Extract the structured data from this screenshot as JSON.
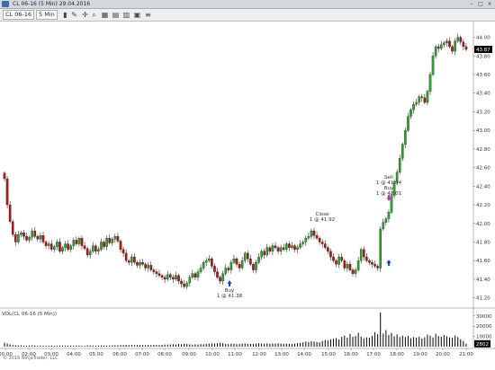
{
  "window": {
    "title": "CL 06-16 (5 Min)  29.04.2016",
    "controls": {
      "minimize": "–",
      "maximize": "□",
      "close": "×"
    }
  },
  "toolbar": {
    "instrument": "CL 06-16",
    "interval": "5 Min",
    "icons": [
      "bar-style-icon",
      "pencil-icon",
      "crosshair-icon",
      "zoom-icon",
      "properties-icon",
      "strategy-icon",
      "chart-trader-icon",
      "data-box-icon",
      "menu-icon"
    ]
  },
  "colors": {
    "up": "#2ea32e",
    "down": "#b01818",
    "wick": "#000000",
    "volume": "#000000",
    "buy_arrow": "#1b3fd6",
    "sell_arrow": "#d21bd6",
    "last_price_bg": "#000000"
  },
  "annotations": {
    "buy1": {
      "label": "Buy",
      "detail": "1 @ 41.38",
      "time": "11:00",
      "price": 41.38
    },
    "close1": {
      "label": "Close",
      "detail": "1 @ 41.92",
      "time": "15:45",
      "price": 41.92
    },
    "sell": {
      "label": "Sell",
      "detail": "1 @ 41.94",
      "time": "17:30",
      "price": 41.94
    },
    "buy2": {
      "label": "Buy",
      "detail": "1 @ 42.01",
      "time": "17:30",
      "price": 42.01
    }
  },
  "volume_panel": {
    "label": "VOL(CL 06-16 (5 Min))",
    "ticks": [
      "30000",
      "20000",
      "10000"
    ],
    "last_value": "2802"
  },
  "copyright": "© 2016 NinjaTrader, LLC",
  "chart_data": [
    {
      "type": "candlestick",
      "title": "CL 06-16 (5 Min)",
      "ylim": [
        41.1,
        44.15
      ],
      "y_ticks": [
        "44.00",
        "43.80",
        "43.60",
        "43.40",
        "43.20",
        "43.00",
        "42.80",
        "42.60",
        "42.40",
        "42.20",
        "42.00",
        "41.80",
        "41.60",
        "41.40",
        "41.20"
      ],
      "x_ticks": [
        "00:00",
        "02:00",
        "03:00",
        "04:00",
        "05:00",
        "06:00",
        "07:00",
        "08:00",
        "09:00",
        "10:00",
        "11:00",
        "12:00",
        "13:00",
        "14:00",
        "15:00",
        "16:00",
        "17:00",
        "18:00",
        "19:00",
        "20:00",
        "21:00"
      ],
      "last_price": "43.87",
      "series": [
        {
          "name": "CL 06-16",
          "values": [
            42.48,
            42.2,
            42.02,
            41.88,
            41.8,
            41.88,
            41.9,
            41.86,
            41.82,
            41.85,
            41.92,
            41.86,
            41.83,
            41.87,
            41.8,
            41.76,
            41.78,
            41.72,
            41.75,
            41.8,
            41.7,
            41.74,
            41.78,
            41.72,
            41.76,
            41.82,
            41.78,
            41.84,
            41.76,
            41.73,
            41.66,
            41.7,
            41.76,
            41.7,
            41.72,
            41.8,
            41.75,
            41.84,
            41.79,
            41.83,
            41.86,
            41.81,
            41.72,
            41.68,
            41.6,
            41.58,
            41.64,
            41.58,
            41.55,
            41.58,
            41.56,
            41.52,
            41.55,
            41.5,
            41.48,
            41.46,
            41.44,
            41.42,
            41.4,
            41.45,
            41.42,
            41.4,
            41.44,
            41.38,
            41.35,
            41.32,
            41.36,
            41.42,
            41.46,
            41.42,
            41.48,
            41.52,
            41.58,
            41.6,
            41.62,
            41.54,
            41.48,
            41.42,
            41.38,
            41.46,
            41.52,
            41.5,
            41.58,
            41.62,
            41.56,
            41.52,
            41.6,
            41.68,
            41.62,
            41.56,
            41.5,
            41.58,
            41.64,
            41.7,
            41.66,
            41.74,
            41.7,
            41.76,
            41.74,
            41.7,
            41.74,
            41.72,
            41.78,
            41.74,
            41.76,
            41.72,
            41.74,
            41.78,
            41.8,
            41.84,
            41.86,
            41.92,
            41.87,
            41.84,
            41.8,
            41.78,
            41.74,
            41.7,
            41.64,
            41.6,
            41.56,
            41.64,
            41.6,
            41.52,
            41.56,
            41.5,
            41.46,
            41.5,
            41.6,
            41.72,
            41.64,
            41.6,
            41.58,
            41.56,
            41.54,
            41.52,
            41.94,
            42.01,
            42.05,
            42.12,
            42.3,
            42.45,
            42.55,
            42.7,
            42.85,
            43.0,
            43.15,
            43.22,
            43.28,
            43.3,
            43.36,
            43.35,
            43.3,
            43.42,
            43.6,
            43.8,
            43.9,
            43.88,
            43.92,
            43.94,
            43.96,
            43.9,
            43.85,
            43.96,
            44.0,
            43.95,
            43.9,
            43.87
          ]
        }
      ]
    },
    {
      "type": "bar",
      "title": "VOL(CL 06-16 (5 Min))",
      "ylim": [
        0,
        36000
      ],
      "y_ticks": [
        "30000",
        "20000",
        "10000"
      ],
      "series": [
        {
          "name": "VOL",
          "values": [
            3800,
            3000,
            2200,
            1600,
            1400,
            1200,
            1300,
            1100,
            1000,
            1200,
            1300,
            1200,
            1000,
            1100,
            1000,
            900,
            1000,
            1100,
            900,
            1000,
            1200,
            1100,
            1000,
            900,
            1100,
            1000,
            1200,
            1100,
            1000,
            900,
            1300,
            1200,
            1100,
            1000,
            1100,
            1200,
            1000,
            1100,
            1200,
            1300,
            1400,
            1300,
            1500,
            1600,
            1700,
            1600,
            1800,
            1500,
            1600,
            1700,
            1600,
            1500,
            1700,
            1600,
            1800,
            1700,
            1600,
            1800,
            2100,
            2000,
            2200,
            2400,
            2000,
            2600,
            2400,
            2800,
            2500,
            2200,
            2000,
            2300,
            2100,
            2500,
            2300,
            2600,
            3000,
            3200,
            2900,
            3300,
            3900,
            3400,
            2700,
            2500,
            2900,
            2800,
            2400,
            2600,
            2900,
            3100,
            2800,
            2700,
            2600,
            3000,
            3400,
            3100,
            2900,
            3200,
            2800,
            3100,
            3000,
            3300,
            2900,
            2700,
            3000,
            2800,
            2600,
            2800,
            3400,
            3800,
            4200,
            5000,
            4600,
            5400,
            4900,
            4500,
            4200,
            5600,
            6500,
            6000,
            7200,
            7800,
            8400,
            7100,
            9600,
            10800,
            8800,
            12500,
            9600,
            10400,
            13400,
            9800,
            8200,
            9100,
            8700,
            10600,
            14200,
            12200,
            33500,
            12800,
            16200,
            11400,
            13400,
            10200,
            12000,
            9400,
            10800,
            9400,
            10600,
            8200,
            9400,
            8800,
            9600,
            8000,
            9200,
            11800,
            10600,
            9000,
            12600,
            10400,
            9600,
            11400,
            10200,
            9000,
            8600,
            11000,
            9400,
            7200,
            5600,
            2802
          ]
        }
      ]
    }
  ]
}
